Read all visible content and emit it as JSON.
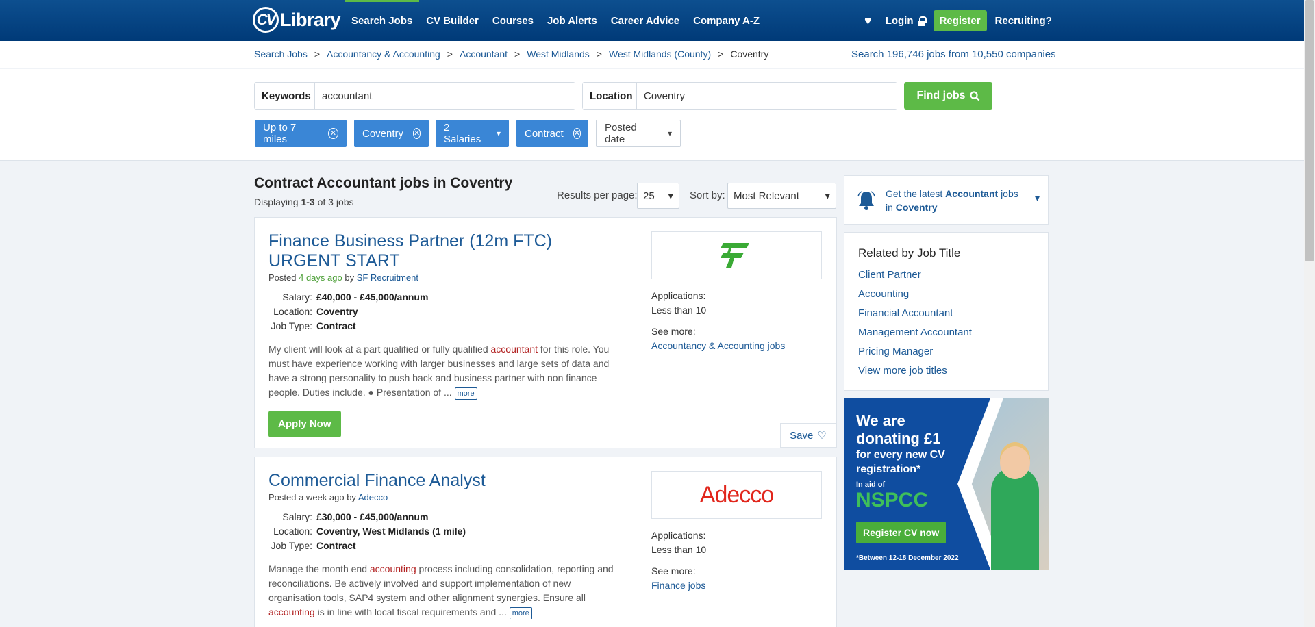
{
  "logo": {
    "cv": "CV",
    "library": "Library"
  },
  "nav": {
    "items": [
      "Search Jobs",
      "CV Builder",
      "Courses",
      "Job Alerts",
      "Career Advice",
      "Company A-Z"
    ]
  },
  "account": {
    "login": "Login",
    "register": "Register",
    "recruiting": "Recruiting?"
  },
  "breadcrumb": {
    "items": [
      "Search Jobs",
      "Accountancy & Accounting",
      "Accountant",
      "West Midlands",
      "West Midlands (County)"
    ],
    "current": "Coventry",
    "sep": ">"
  },
  "stats": {
    "prefix": "Search",
    "jobs": "196,746 jobs",
    "middle": "from",
    "companies": "10,550 companies"
  },
  "search": {
    "keywords_label": "Keywords",
    "keywords_value": "accountant",
    "location_label": "Location",
    "location_value": "Coventry",
    "find_label": "Find jobs"
  },
  "filters": {
    "distance": "Up to 7 miles",
    "location": "Coventry",
    "salaries": "2 Salaries",
    "type": "Contract",
    "posted": "Posted date"
  },
  "results": {
    "title": "Contract Accountant jobs in Coventry",
    "displaying_prefix": "Displaying",
    "displaying_range": "1-3",
    "displaying_suffix": "of 3 jobs",
    "per_page_label": "Results per page:",
    "per_page_value": "25",
    "sort_label": "Sort by:",
    "sort_value": "Most Relevant"
  },
  "jobs": [
    {
      "title": "Finance Business Partner (12m FTC) URGENT START",
      "posted_prefix": "Posted",
      "posted_when": "4 days ago",
      "posted_by": "by",
      "company": "SF Recruitment",
      "salary_label": "Salary:",
      "salary": "£40,000 - £45,000/annum",
      "location_label": "Location:",
      "location": "Coventry",
      "type_label": "Job Type:",
      "type": "Contract",
      "desc_a": "My client will look at a part qualified or fully qualified ",
      "desc_hl": "accountant",
      "desc_b": " for this role. You must have experience working with larger businesses and large sets of data and have a strong personality to push back and business partner with non finance people. Duties include. ● Presentation of ... ",
      "more": "more",
      "apply": "Apply Now",
      "applications_label": "Applications:",
      "applications": "Less than 10",
      "see_more_label": "See more:",
      "see_more_link": "Accountancy & Accounting jobs",
      "save": "Save",
      "logo_text": "SF"
    },
    {
      "title": "Commercial Finance Analyst",
      "posted_prefix": "Posted a week ago",
      "posted_by": "by",
      "company": "Adecco",
      "salary_label": "Salary:",
      "salary": "£30,000 - £45,000/annum",
      "location_label": "Location:",
      "location": "Coventry, West Midlands (1 mile)",
      "type_label": "Job Type:",
      "type": "Contract",
      "desc_a": "Manage the month end ",
      "desc_hl": "accounting",
      "desc_b": " process including consolidation, reporting and reconciliations. Be actively involved and support implementation of new organisation tools, SAP4 system and other alignment synergies. Ensure all ",
      "desc_hl2": "accounting",
      "desc_c": " is in line with local fiscal requirements and ... ",
      "more": "more",
      "applications_label": "Applications:",
      "applications": "Less than 10",
      "see_more_label": "See more:",
      "see_more_link": "Finance jobs",
      "logo_text": "Adecco"
    }
  ],
  "alert": {
    "prefix": "Get the latest",
    "job": "Accountant",
    "middle": "jobs in",
    "place": "Coventry"
  },
  "related": {
    "title": "Related by Job Title",
    "items": [
      "Client Partner",
      "Accounting",
      "Financial Accountant",
      "Management Accountant",
      "Pricing Manager",
      "View more job titles"
    ]
  },
  "ad": {
    "line1": "We are",
    "line2": "donating £1",
    "line3": "for every new CV",
    "line4": "registration*",
    "line5": "In aid of",
    "brand": "NSPCC",
    "button": "Register CV now",
    "footnote": "*Between 12-18 December 2022"
  },
  "colors": {
    "brand_blue": "#0d4f8f",
    "accent_green": "#5dba47",
    "chip_blue": "#3a86d6",
    "link": "#1d5a96",
    "highlight": "#b22222"
  },
  "icons": [
    "heart-icon",
    "lock-icon",
    "search-icon",
    "x-circle-icon",
    "chevron-down-icon",
    "bell-icon"
  ]
}
